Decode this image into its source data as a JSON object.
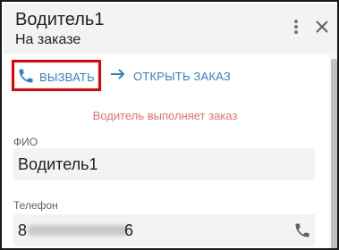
{
  "header": {
    "title": "Водитель1",
    "subtitle": "На заказе",
    "menu_icon": "more-vertical-icon",
    "close_icon": "close-icon"
  },
  "actions": {
    "call_label": "ВЫЗВАТЬ",
    "call_icon": "phone-icon",
    "open_order_label": "ОТКРЫТЬ ЗАКАЗ",
    "open_order_icon": "arrow-right-icon"
  },
  "status_text": "Водитель выполняет заказ",
  "fields": {
    "fio": {
      "label": "ФИО",
      "value": "Водитель1"
    },
    "phone": {
      "label": "Телефон",
      "value_start": "8",
      "value_end": "6",
      "icon": "phone-icon"
    }
  },
  "colors": {
    "accent": "#2f80d1",
    "highlight": "#e60000",
    "status": "#ef6d6d",
    "header_bg": "#f3f3f3"
  }
}
